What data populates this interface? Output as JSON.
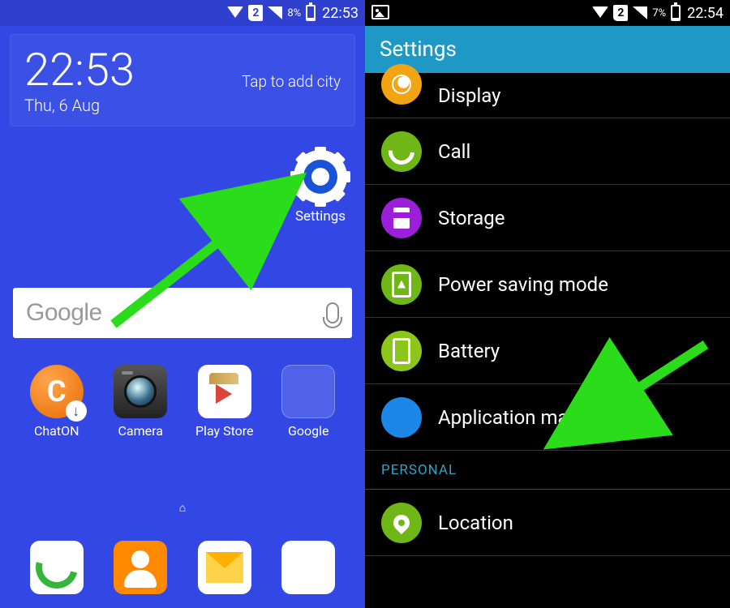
{
  "left": {
    "status": {
      "sim": "2",
      "battery_pct": "8%",
      "time": "22:53"
    },
    "clock": {
      "time": "22:53",
      "date": "Thu, 6 Aug",
      "add_city": "Tap to add city"
    },
    "settings_shortcut": {
      "label": "Settings"
    },
    "search": {
      "logo": "Google"
    },
    "apps": [
      {
        "label": "ChatON"
      },
      {
        "label": "Camera"
      },
      {
        "label": "Play Store"
      },
      {
        "label": "Google"
      }
    ],
    "home_indicator": "⌂"
  },
  "right": {
    "status": {
      "sim": "2",
      "battery_pct": "7%",
      "time": "22:54"
    },
    "header": "Settings",
    "rows": [
      {
        "label": "Display"
      },
      {
        "label": "Call"
      },
      {
        "label": "Storage"
      },
      {
        "label": "Power saving mode"
      },
      {
        "label": "Battery"
      },
      {
        "label": "Application manager"
      }
    ],
    "section": "PERSONAL",
    "rows2": [
      {
        "label": "Location"
      }
    ]
  }
}
